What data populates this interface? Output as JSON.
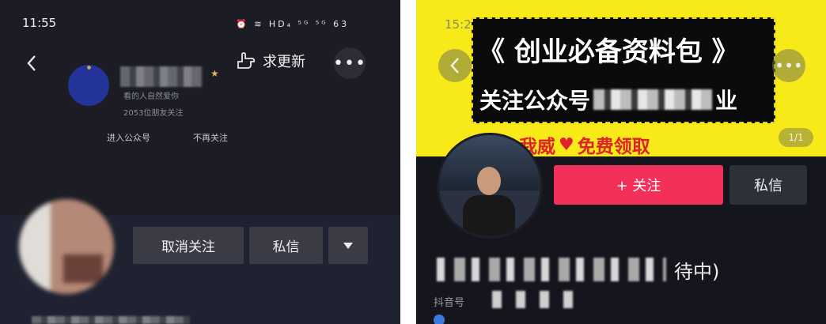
{
  "left": {
    "status": {
      "time": "11:55",
      "icons": "⏰ ≋ HD₄ ⁵ᴳ ⁵ᴳ 63"
    },
    "header": {
      "request_update": "求更新"
    },
    "official": {
      "enter_account": "进入公众号",
      "unfollow_account": "不再关注",
      "desc_fragment": "看的人自然爱你",
      "followers_fragment": "2053位朋友关注"
    },
    "actions": {
      "unfollow": "取消关注",
      "message": "私信"
    }
  },
  "right": {
    "status": {
      "time": "15:23"
    },
    "banner": {
      "line1": "《 创业必备资料包 》",
      "line2_prefix": "关注公众号",
      "line2_suffix": "业",
      "line3_a": "我威",
      "line3_b": "免费领取"
    },
    "page_counter": "1/1",
    "actions": {
      "follow": "+ 关注",
      "message": "私信"
    },
    "profile": {
      "name_tail": "待中)",
      "id_label": "抖音号"
    }
  }
}
